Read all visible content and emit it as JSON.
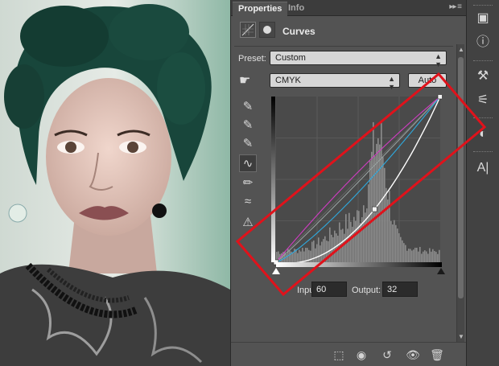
{
  "panel": {
    "tabs": [
      {
        "label": "Properties"
      },
      {
        "label": "Info"
      }
    ],
    "menu_glyph": "▸▸ ≡",
    "title": "Curves",
    "preset": {
      "label": "Preset:",
      "value": "Custom"
    },
    "channel": {
      "value": "CMYK"
    },
    "auto_label": "Auto",
    "input": {
      "label": "Input:",
      "value": "60"
    },
    "output": {
      "label": "Output:",
      "value": "32"
    }
  },
  "icons": {
    "panel_header": [
      "curves-adjustment-icon",
      "mask-icon"
    ],
    "left_tools": [
      "on-image-adjust-icon",
      "black-point-eyedropper-icon",
      "gray-point-eyedropper-icon",
      "white-point-eyedropper-icon",
      "curve-edit-icon",
      "pencil-icon",
      "smooth-icon",
      "clipping-warning-icon"
    ],
    "bottom_bar": [
      "clip-to-layer-icon",
      "view-previous-icon",
      "reset-icon",
      "visibility-icon",
      "delete-icon"
    ],
    "dock": [
      "3d-icon",
      "info-icon",
      "brush-presets-icon",
      "adjustments-icon",
      "color-swatch-icon",
      "character-icon"
    ]
  },
  "curves": {
    "channel": "CMYK",
    "input": 60,
    "output": 32,
    "composite_points": [
      [
        0,
        0
      ],
      [
        60,
        32
      ],
      [
        100,
        100
      ]
    ],
    "colors": {
      "composite": "#ffffff",
      "cyan": "#2eaadf",
      "magenta": "#d13cc3",
      "yellow": "#9aa4a3"
    }
  },
  "colors": {
    "annotation": "#e0121b",
    "panel_bg": "#535353",
    "graph_bg": "#4a4a4a"
  }
}
